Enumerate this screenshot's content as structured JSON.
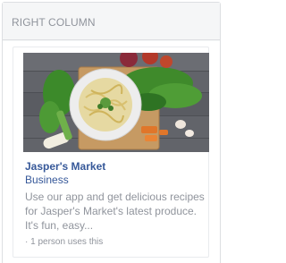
{
  "panel": {
    "title": "RIGHT COLUMN"
  },
  "app": {
    "image_alt": "Bowl of pasta with fresh vegetables",
    "name": "Jasper's Market",
    "category": "Business",
    "description": "Use our app and get delicious recipes for Jasper's Market's latest produce. It's fun, easy...",
    "usage": "· 1 person uses this"
  },
  "colors": {
    "link": "#365899",
    "muted_text": "#90949c",
    "border": "#dddfe2",
    "header_bg": "#f5f6f7"
  },
  "icons": [
    "food-photo"
  ]
}
